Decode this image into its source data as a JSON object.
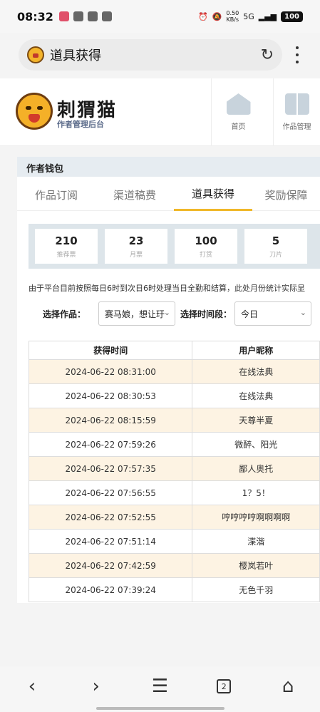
{
  "status_bar": {
    "time": "08:32",
    "speed": "0.50",
    "speed_unit": "KB/s",
    "battery": "100",
    "network": "5G"
  },
  "browser": {
    "page_title": "道具获得"
  },
  "site": {
    "brand_name": "刺猬猫",
    "brand_sub": "作者管理后台",
    "nav": [
      {
        "label": "首页",
        "icon": "house-icon"
      },
      {
        "label": "作品管理",
        "icon": "book-icon"
      }
    ]
  },
  "wallet": {
    "title": "作者钱包"
  },
  "tabs": [
    "作品订阅",
    "渠道稿费",
    "道具获得",
    "奖励保障"
  ],
  "active_tab": "道具获得",
  "stats": [
    {
      "value": "210",
      "label": "推荐票"
    },
    {
      "value": "23",
      "label": "月票"
    },
    {
      "value": "100",
      "label": "打赏"
    },
    {
      "value": "5",
      "label": "刀片"
    }
  ],
  "notice": "由于平台目前按照每日6时到次日6时处理当日全勤和结算，此处月份统计实际显",
  "filters": {
    "work_label": "选择作品：",
    "work_value": "赛马娘，想让玗",
    "period_label": "选择时间段：",
    "period_value": "今日"
  },
  "table": {
    "headers": [
      "获得时间",
      "用户昵称"
    ],
    "rows": [
      [
        "2024-06-22 08:31:00",
        "在线法典"
      ],
      [
        "2024-06-22 08:30:53",
        "在线法典"
      ],
      [
        "2024-06-22 08:15:59",
        "天尊半夏"
      ],
      [
        "2024-06-22 07:59:26",
        "微醉、阳光"
      ],
      [
        "2024-06-22 07:57:35",
        "鄙人奥托"
      ],
      [
        "2024-06-22 07:56:55",
        "1？5！"
      ],
      [
        "2024-06-22 07:52:55",
        "哼哼哼哼啊啊啊啊"
      ],
      [
        "2024-06-22 07:51:14",
        "渫湝"
      ],
      [
        "2024-06-22 07:42:59",
        "樱岚若叶"
      ],
      [
        "2024-06-22 07:39:24",
        "无色千羽"
      ]
    ]
  },
  "bottom_nav": {
    "tab_count": "2"
  }
}
